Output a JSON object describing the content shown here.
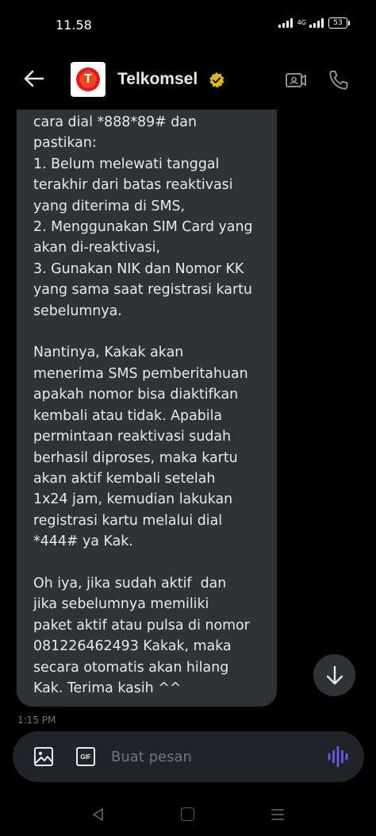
{
  "status_bar": {
    "time": "11.58",
    "network": "4G",
    "battery": "53"
  },
  "header": {
    "title": "Telkomsel",
    "avatar_letter": "T",
    "verified_color": "#e2b719"
  },
  "message": {
    "text": "cara dial *888*89# dan\npastikan:\n1. Belum melewati tanggal\nterakhir dari batas reaktivasi\nyang diterima di SMS,\n2. Menggunakan SIM Card yang\nakan di-reaktivasi,\n3. Gunakan NIK dan Nomor KK\nyang sama saat registrasi kartu\nsebelumnya.\n\nNantinya, Kakak akan\nmenerima SMS pemberitahuan\napakah nomor bisa diaktifkan\nkembali atau tidak. Apabila\npermintaan reaktivasi sudah\nberhasil diproses, maka kartu\nakan aktif kembali setelah\n1x24 jam, kemudian lakukan\nregistrasi kartu melalui dial\n*444# ya Kak.\n\nOh iya, jika sudah aktif  dan\njika sebelumnya memiliki\npaket aktif atau pulsa di nomor\n081226462493 Kakak, maka\nsecara otomatis akan hilang\nKak. Terima kasih ^^",
    "timestamp": "1:15 PM"
  },
  "composer": {
    "placeholder": "Buat pesan",
    "gif_label": "GIF",
    "accent_color": "#7856ff"
  },
  "icons": [
    "back-arrow-icon",
    "verified-badge-icon",
    "video-call-icon",
    "phone-icon",
    "arrow-down-icon",
    "image-icon",
    "gif-icon",
    "voice-wave-icon"
  ]
}
